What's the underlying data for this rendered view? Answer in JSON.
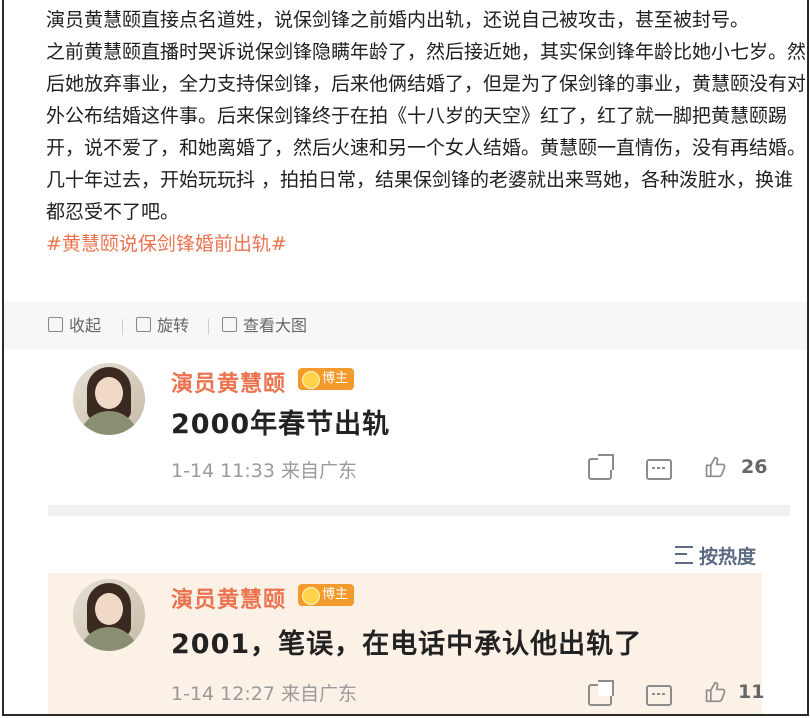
{
  "post": {
    "paragraphs": [
      "演员黄慧颐直接点名道姓，说保剑锋之前婚内出轨，还说自己被攻击，甚至被封号。",
      "之前黄慧颐直播时哭诉说保剑锋隐瞒年龄了，然后接近她，其实保剑锋年龄比她小七岁。然后她放弃事业，全力支持保剑锋，后来他俩结婚了，但是为了保剑锋的事业，黄慧颐没有对外公布结婚这件事。后来保剑锋终于在拍《十八岁的天空》红了，红了就一脚把黄慧颐踢开，说不爱了，和她离婚了，然后火速和另一个女人结婚。黄慧颐一直情伤，没有再结婚。几十年过去，开始玩玩抖 ，拍拍日常，结果保剑锋的老婆就出来骂她，各种泼脏水，换谁都忍受不了吧。"
    ],
    "hashtag": "#黄慧颐说保剑锋婚前出轨#"
  },
  "toolbar": {
    "collapse_label": "收起",
    "rotate_label": "旋转",
    "view_large_label": "查看大图"
  },
  "screenshot": {
    "comment": {
      "author": "演员黄慧颐",
      "badge": "博主",
      "text": "2000年春节出轨",
      "time_source": "1-14 11:33 来自广东",
      "likes": "26"
    },
    "sort_label": "按热度",
    "reply": {
      "author": "演员黄慧颐",
      "badge": "博主",
      "text": "2001，笔误，在电话中承认他出轨了",
      "time_source": "1-14 12:27 来自广东",
      "likes": "11"
    }
  },
  "colors": {
    "accent": "#eb7350",
    "badge": "#f39a2c",
    "reply_bg": "#fbf1e6",
    "sort": "#5d6b82"
  }
}
